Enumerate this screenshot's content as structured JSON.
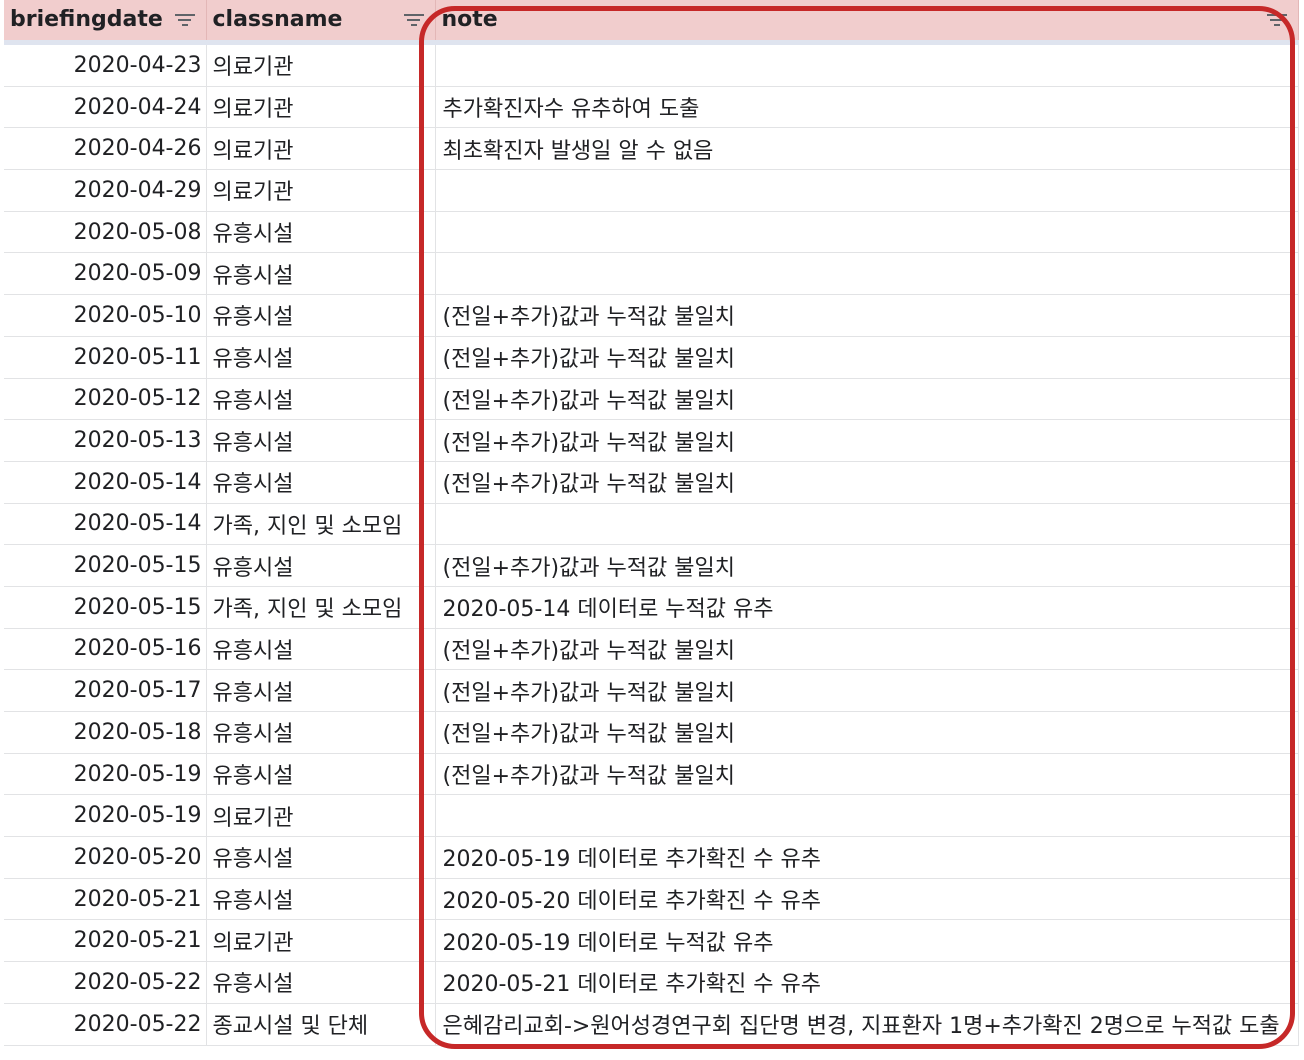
{
  "columns": {
    "date": "briefingdate",
    "class": "classname",
    "note": "note"
  },
  "icons": {
    "filter": "filter-icon"
  },
  "colors": {
    "header_bg": "#f1cdcd",
    "highlight": "#c62828"
  },
  "rows": [
    {
      "date": "2020-04-23",
      "class": "의료기관",
      "note": ""
    },
    {
      "date": "2020-04-24",
      "class": "의료기관",
      "note": "추가확진자수 유추하여 도출"
    },
    {
      "date": "2020-04-26",
      "class": "의료기관",
      "note": "최초확진자 발생일 알 수 없음"
    },
    {
      "date": "2020-04-29",
      "class": "의료기관",
      "note": ""
    },
    {
      "date": "2020-05-08",
      "class": "유흥시설",
      "note": ""
    },
    {
      "date": "2020-05-09",
      "class": "유흥시설",
      "note": ""
    },
    {
      "date": "2020-05-10",
      "class": "유흥시설",
      "note": "(전일+추가)값과 누적값 불일치"
    },
    {
      "date": "2020-05-11",
      "class": "유흥시설",
      "note": "(전일+추가)값과 누적값 불일치"
    },
    {
      "date": "2020-05-12",
      "class": "유흥시설",
      "note": "(전일+추가)값과 누적값 불일치"
    },
    {
      "date": "2020-05-13",
      "class": "유흥시설",
      "note": "(전일+추가)값과 누적값 불일치"
    },
    {
      "date": "2020-05-14",
      "class": "유흥시설",
      "note": "(전일+추가)값과 누적값 불일치"
    },
    {
      "date": "2020-05-14",
      "class": "가족, 지인 및 소모임",
      "note": ""
    },
    {
      "date": "2020-05-15",
      "class": "유흥시설",
      "note": "(전일+추가)값과 누적값 불일치"
    },
    {
      "date": "2020-05-15",
      "class": "가족, 지인 및 소모임",
      "note": "2020-05-14 데이터로 누적값 유추"
    },
    {
      "date": "2020-05-16",
      "class": "유흥시설",
      "note": "(전일+추가)값과 누적값 불일치"
    },
    {
      "date": "2020-05-17",
      "class": "유흥시설",
      "note": "(전일+추가)값과 누적값 불일치"
    },
    {
      "date": "2020-05-18",
      "class": "유흥시설",
      "note": "(전일+추가)값과 누적값 불일치"
    },
    {
      "date": "2020-05-19",
      "class": "유흥시설",
      "note": "(전일+추가)값과 누적값 불일치"
    },
    {
      "date": "2020-05-19",
      "class": "의료기관",
      "note": ""
    },
    {
      "date": "2020-05-20",
      "class": "유흥시설",
      "note": "2020-05-19 데이터로 추가확진 수 유추"
    },
    {
      "date": "2020-05-21",
      "class": "유흥시설",
      "note": "2020-05-20 데이터로 추가확진 수 유추"
    },
    {
      "date": "2020-05-21",
      "class": "의료기관",
      "note": "2020-05-19 데이터로 누적값 유추"
    },
    {
      "date": "2020-05-22",
      "class": "유흥시설",
      "note": "2020-05-21 데이터로 추가확진 수 유추"
    },
    {
      "date": "2020-05-22",
      "class": "종교시설 및 단체",
      "note": "은혜감리교회->원어성경연구회 집단명 변경, 지표환자 1명+추가확진 2명으로 누적값 도출"
    }
  ]
}
